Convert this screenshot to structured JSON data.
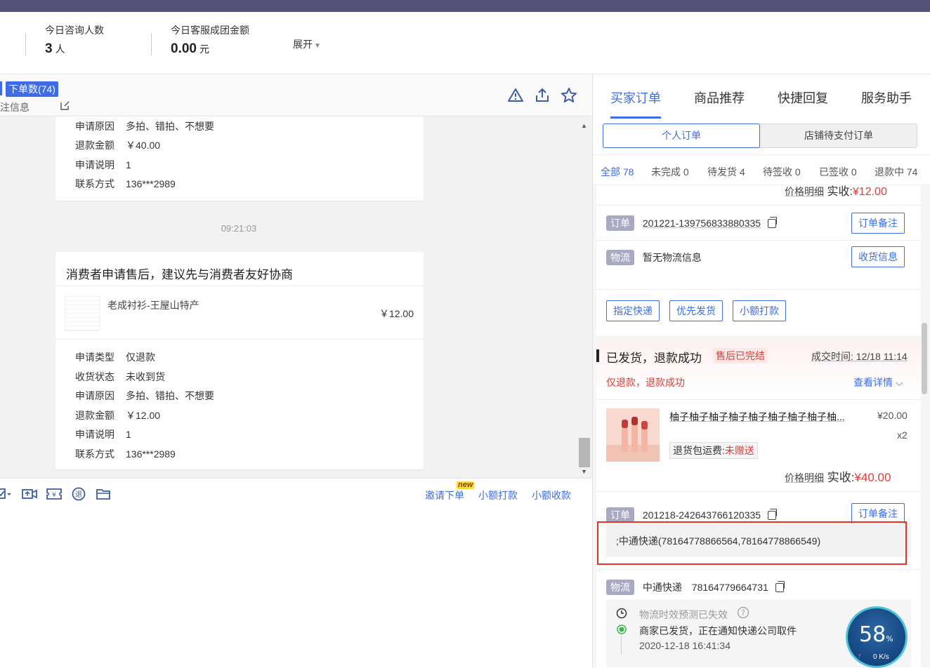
{
  "stats": {
    "consult_label": "今日咨询人数",
    "consult_value": "3",
    "consult_unit": "人",
    "amount_label": "今日客服成团金额",
    "amount_value": "0.00",
    "amount_unit": "元",
    "expand_label": "展开"
  },
  "chat": {
    "order_count_badge": "下单数(74)",
    "note_label": "备注信息",
    "card1": {
      "rows": [
        {
          "k": "申请原因",
          "v": "多拍、错拍、不想要"
        },
        {
          "k": "退款金额",
          "v": "￥40.00"
        },
        {
          "k": "申请说明",
          "v": "1"
        },
        {
          "k": "联系方式",
          "v": "136***2989"
        }
      ]
    },
    "timestamp": "09:21:03",
    "card2": {
      "title": "消费者申请售后，建议先与消费者友好协商",
      "product_name": "老成衬衫-王屋山特产",
      "product_price": "￥12.00",
      "rows": [
        {
          "k": "申请类型",
          "v": "仅退款"
        },
        {
          "k": "收货状态",
          "v": "未收到货"
        },
        {
          "k": "申请原因",
          "v": "多拍、错拍、不想要"
        },
        {
          "k": "退款金额",
          "v": "￥12.00"
        },
        {
          "k": "申请说明",
          "v": "1"
        },
        {
          "k": "联系方式",
          "v": "136***2989"
        }
      ]
    },
    "toolbar": {
      "invite_order": "邀请下单",
      "new_tag": "new",
      "small_pay": "小额打款",
      "small_collect": "小额收款"
    }
  },
  "right": {
    "tabs": [
      "买家订单",
      "商品推荐",
      "快捷回复",
      "服务助手"
    ],
    "segments": [
      "个人订单",
      "店铺待支付订单"
    ],
    "filters": [
      {
        "label": "全部",
        "count": "78"
      },
      {
        "label": "未完成",
        "count": "0"
      },
      {
        "label": "待发货",
        "count": "4"
      },
      {
        "label": "待签收",
        "count": "0"
      },
      {
        "label": "已签收",
        "count": "0"
      },
      {
        "label": "退款中",
        "count": "74"
      }
    ],
    "order1": {
      "price_detail": "价格明细",
      "paid_label": "实收:",
      "paid_value": "¥12.00",
      "order_tag": "订单",
      "order_no": "201221-139756833880335",
      "order_note_btn": "订单备注",
      "logistics_tag": "物流",
      "logistics_text": "暂无物流信息",
      "receive_btn": "收货信息",
      "btn_express": "指定快递",
      "btn_priority": "优先发货",
      "btn_small_pay": "小额打款"
    },
    "order2": {
      "status": "已发货，退款成功",
      "after_sale_badge": "售后已完结",
      "deal_time": "成交时间: 12/18 11:14",
      "refund_status": "仅退款，退款成功",
      "view_detail": "查看详情",
      "product_name": "柚子柚子柚子柚子柚子柚子柚子柚子柚...",
      "product_price": "¥20.00",
      "product_qty": "x2",
      "return_ship_label": "退货包运费:",
      "return_ship_value": "未赠送",
      "price_detail": "价格明细",
      "paid_label": "实收:",
      "paid_value": "¥40.00",
      "order_tag": "订单",
      "order_no": "201218-242643766120335",
      "order_note_btn": "订单备注",
      "express_info": ";中通快递(78164778866564,78164778866549)",
      "logistics_tag": "物流",
      "carrier": "中通快递",
      "tracking_no": "78164779664731",
      "predict_text": "物流时效预测已失效",
      "event_text": "商家已发货，正在通知快递公司取件",
      "event_time": "2020-12-18 16:41:34"
    }
  },
  "gauge": {
    "percent": "58",
    "percent_unit": "%",
    "speed": "0 K/s"
  },
  "colors": {
    "accent": "#3d6ce6",
    "topbar": "#56527a",
    "red": "#e53935",
    "highlight": "#e8321e"
  }
}
